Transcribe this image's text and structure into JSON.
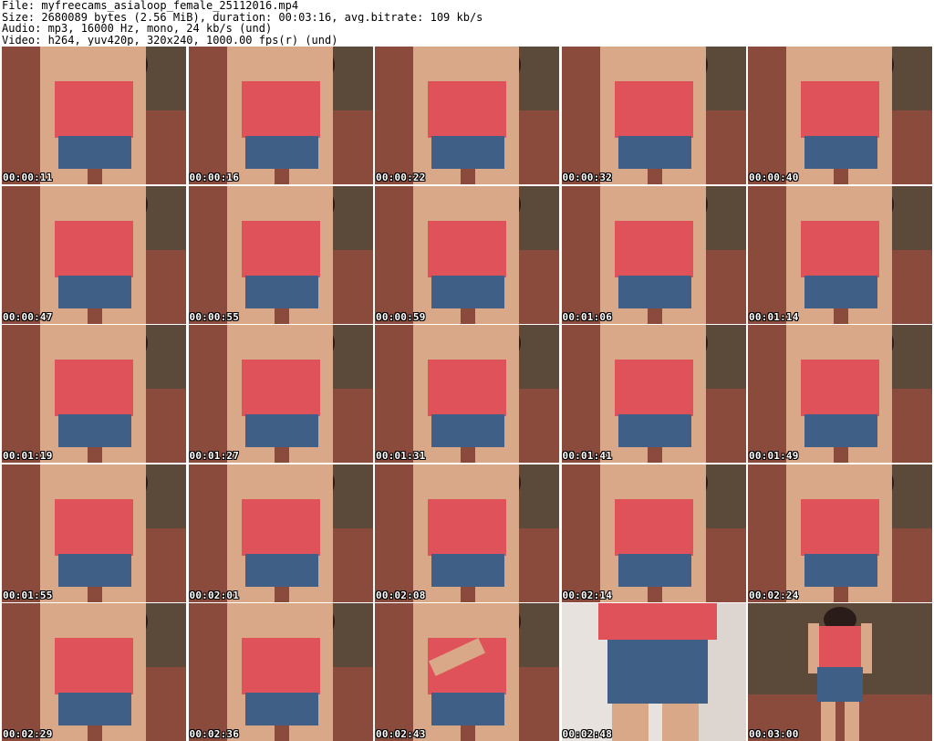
{
  "header": {
    "file_line": "File: myfreecams_asialoop_female_25112016.mp4",
    "size_line": "Size: 2680089 bytes (2.56 MiB), duration: 00:03:16, avg.bitrate: 109 kb/s",
    "audio_line": "Audio: mp3, 16000 Hz, mono, 24 kb/s (und)",
    "video_line": "Video: h264, yuv420p, 320x240, 1000.00 fps(r) (und)"
  },
  "thumbnails": [
    {
      "timestamp": "00:00:11"
    },
    {
      "timestamp": "00:00:16"
    },
    {
      "timestamp": "00:00:22"
    },
    {
      "timestamp": "00:00:32"
    },
    {
      "timestamp": "00:00:40"
    },
    {
      "timestamp": "00:00:47"
    },
    {
      "timestamp": "00:00:55"
    },
    {
      "timestamp": "00:00:59"
    },
    {
      "timestamp": "00:01:06"
    },
    {
      "timestamp": "00:01:14"
    },
    {
      "timestamp": "00:01:19"
    },
    {
      "timestamp": "00:01:27"
    },
    {
      "timestamp": "00:01:31"
    },
    {
      "timestamp": "00:01:41"
    },
    {
      "timestamp": "00:01:49"
    },
    {
      "timestamp": "00:01:55"
    },
    {
      "timestamp": "00:02:01"
    },
    {
      "timestamp": "00:02:08"
    },
    {
      "timestamp": "00:02:14"
    },
    {
      "timestamp": "00:02:24"
    },
    {
      "timestamp": "00:02:29"
    },
    {
      "timestamp": "00:02:36"
    },
    {
      "timestamp": "00:02:43"
    },
    {
      "timestamp": "00:02:48"
    },
    {
      "timestamp": "00:03:00"
    }
  ],
  "colors": {
    "background": "#ffffff",
    "header_text": "#000000",
    "timestamp_text": "#ffffff",
    "timestamp_outline": "#000000",
    "couch": "#8a4b3c",
    "tank_top": "#e0525a",
    "denim": "#3f5f86",
    "skin": "#d9a888",
    "hair": "#2a1c18",
    "curtain": "#5b4a3a"
  }
}
